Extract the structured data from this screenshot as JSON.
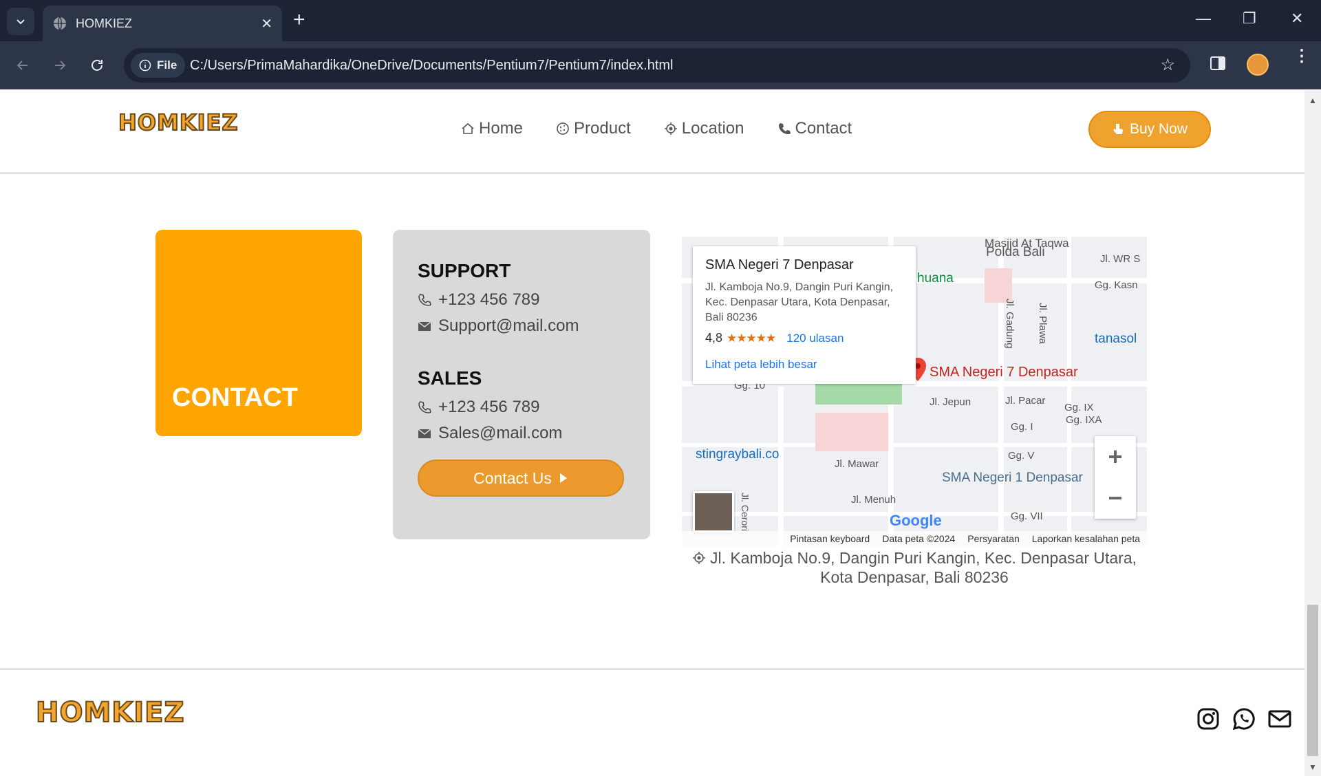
{
  "browser": {
    "tab_title": "HOMKIEZ",
    "file_chip": "File",
    "url": "C:/Users/PrimaMahardika/OneDrive/Documents/Pentium7/Pentium7/index.html"
  },
  "navbar": {
    "logo": "HOMKIEZ",
    "items": [
      {
        "label": "Home",
        "icon": "home-icon"
      },
      {
        "label": "Product",
        "icon": "cookie-icon"
      },
      {
        "label": "Location",
        "icon": "location-icon"
      },
      {
        "label": "Contact",
        "icon": "phone-icon"
      }
    ],
    "buy_label": "Buy Now"
  },
  "contact_box": {
    "title": "CONTACT"
  },
  "support": {
    "title": "SUPPORT",
    "phone": "+123 456 789",
    "email": "Support@mail.com"
  },
  "sales": {
    "title": "SALES",
    "phone": "+123 456 789",
    "email": "Sales@mail.com",
    "button": "Contact Us"
  },
  "map": {
    "popup_title": "SMA Negeri 7 Denpasar",
    "popup_address": "Jl. Kamboja No.9, Dangin Puri Kangin, Kec. Denpasar Utara, Kota Denpasar, Bali 80236",
    "rating": "4,8",
    "stars": "★★★★★",
    "reviews": "120 ulasan",
    "view_larger": "Lihat peta lebih besar",
    "pin_label": "SMA Negeri 7 Denpasar",
    "labels": {
      "polda": "Polda Bali",
      "masjid": "Masjid At Taqwa",
      "wr": "Jl. WR S",
      "kasn": "Gg. Kasn",
      "tanasol": "tanasol",
      "gadung": "Jl. Gadung",
      "plawa": "Jl. Plawa",
      "jepun": "Jl. Jepun",
      "pacar": "Jl. Pacar",
      "gg9": "Gg. IX",
      "gg9a": "Gg. IXA",
      "gg1": "Gg. I",
      "gg5": "Gg. V",
      "gg7": "Gg. VII",
      "gg10": "Gg. 10",
      "mawar": "Jl. Mawar",
      "menuh": "Jl. Menuh",
      "cerori": "Jl. Cerori",
      "stingray": "stingraybali.co",
      "sma1": "SMA Negeri 1 Denpasar",
      "huana": "huana"
    },
    "google": "Google",
    "footer": [
      "Pintasan keyboard",
      "Data peta ©2024",
      "Persyaratan",
      "Laporkan kesalahan peta"
    ]
  },
  "address": "Jl. Kamboja No.9, Dangin Puri Kangin, Kec. Denpasar Utara, Kota Denpasar, Bali 80236",
  "footer": {
    "logo": "HOMKIEZ"
  },
  "colors": {
    "accent": "#f0a22e",
    "contact_box": "#fea502",
    "card": "#d9d9d9"
  }
}
